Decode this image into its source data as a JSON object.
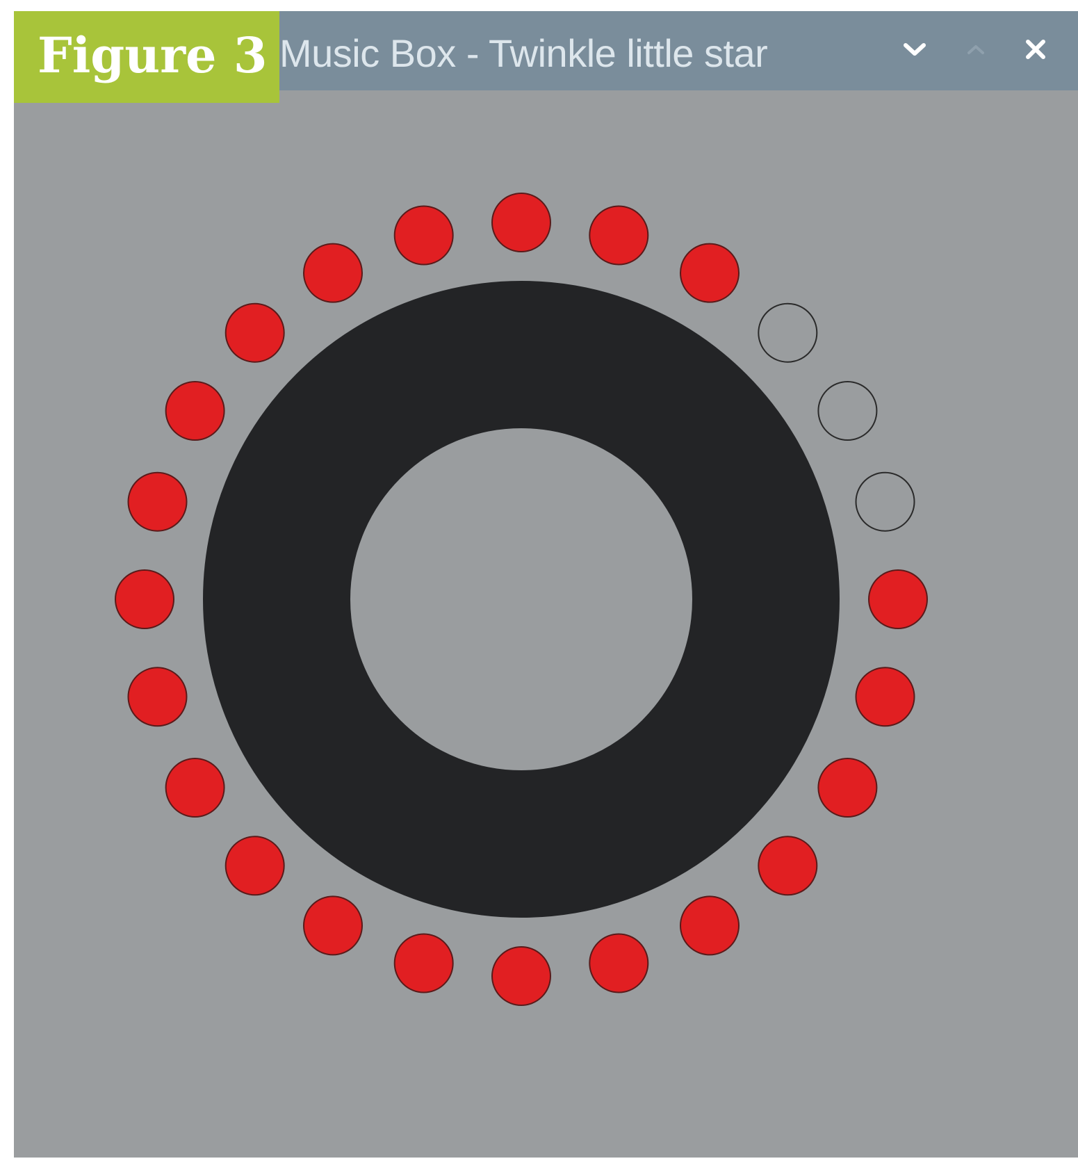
{
  "figure_label": "Figure 3",
  "window": {
    "title": "Music Box - Twinkle little star",
    "controls": [
      {
        "name": "minimize",
        "icon": "chevron-down-icon"
      },
      {
        "name": "maximize",
        "icon": "chevron-up-icon"
      },
      {
        "name": "close",
        "icon": "close-icon"
      }
    ]
  },
  "music_box": {
    "total_notes": 24,
    "hollow_note_positions": [
      3,
      4,
      5
    ],
    "note_fill_color": "#e11f22",
    "note_outline_color": "#5a1a1a",
    "ring_color": "#232426",
    "background_color": "#9a9d9f"
  },
  "colors": {
    "titlebar": "#7a8d9b",
    "title_text": "#dde6ec",
    "figure_label_bg": "#a8c43a"
  }
}
